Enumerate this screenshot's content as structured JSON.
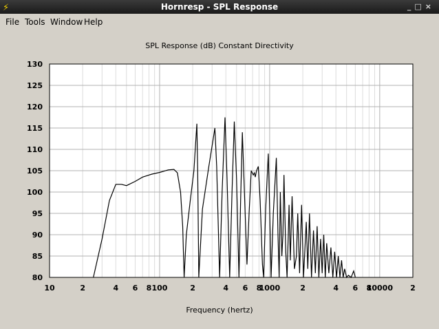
{
  "window": {
    "title": "Hornresp - SPL Response",
    "controls": [
      "_",
      "□",
      "×"
    ]
  },
  "menu": [
    "File",
    "Tools",
    "Window",
    "Help"
  ],
  "chart_data": {
    "type": "line",
    "title": "SPL Response (dB)   Constant Directivity",
    "xlabel": "Frequency (hertz)",
    "ylabel": "",
    "xscale": "log",
    "xlim": [
      10,
      20000
    ],
    "ylim": [
      80,
      130
    ],
    "yticks": [
      "130",
      "125",
      "120",
      "115",
      "110",
      "105",
      "100",
      "95",
      "90",
      "85",
      "80"
    ],
    "xticks": [
      {
        "v": 10,
        "l": "10"
      },
      {
        "v": 20,
        "l": "2"
      },
      {
        "v": 40,
        "l": "4"
      },
      {
        "v": 60,
        "l": "6"
      },
      {
        "v": 80,
        "l": "8"
      },
      {
        "v": 100,
        "l": "100"
      },
      {
        "v": 200,
        "l": "2"
      },
      {
        "v": 400,
        "l": "4"
      },
      {
        "v": 600,
        "l": "6"
      },
      {
        "v": 800,
        "l": "8"
      },
      {
        "v": 1000,
        "l": "1000"
      },
      {
        "v": 2000,
        "l": "2"
      },
      {
        "v": 4000,
        "l": "4"
      },
      {
        "v": 6000,
        "l": "6"
      },
      {
        "v": 8000,
        "l": "8"
      },
      {
        "v": 10000,
        "l": "10000"
      },
      {
        "v": 20000,
        "l": "2"
      }
    ],
    "grid": true,
    "series": [
      {
        "name": "SPL",
        "points": [
          [
            25,
            80
          ],
          [
            30,
            89
          ],
          [
            35,
            98
          ],
          [
            40,
            101.8
          ],
          [
            45,
            101.8
          ],
          [
            50,
            101.5
          ],
          [
            60,
            102.5
          ],
          [
            70,
            103.5
          ],
          [
            85,
            104.2
          ],
          [
            100,
            104.6
          ],
          [
            120,
            105.2
          ],
          [
            135,
            105.3
          ],
          [
            145,
            104.5
          ],
          [
            155,
            100
          ],
          [
            162,
            92
          ],
          [
            167,
            80
          ],
          [
            175,
            90
          ],
          [
            190,
            98
          ],
          [
            205,
            105
          ],
          [
            218,
            116
          ],
          [
            222,
            105
          ],
          [
            227,
            80
          ],
          [
            245,
            96
          ],
          [
            280,
            106
          ],
          [
            305,
            112
          ],
          [
            318,
            115
          ],
          [
            330,
            106
          ],
          [
            351,
            80
          ],
          [
            370,
            100
          ],
          [
            393,
            117.5
          ],
          [
            410,
            103
          ],
          [
            433,
            80
          ],
          [
            455,
            100
          ],
          [
            477,
            116.5
          ],
          [
            500,
            103
          ],
          [
            526,
            80
          ],
          [
            545,
            98
          ],
          [
            565,
            114
          ],
          [
            590,
            100
          ],
          [
            622,
            83
          ],
          [
            650,
            95
          ],
          [
            680,
            105
          ],
          [
            710,
            104
          ],
          [
            726,
            104.5
          ],
          [
            740,
            103.5
          ],
          [
            760,
            105
          ],
          [
            789,
            106
          ],
          [
            820,
            98
          ],
          [
            860,
            83
          ],
          [
            881,
            80
          ],
          [
            920,
            96
          ],
          [
            972,
            109
          ],
          [
            1000,
            96
          ],
          [
            1030,
            80
          ],
          [
            1080,
            95
          ],
          [
            1150,
            108
          ],
          [
            1190,
            90
          ],
          [
            1220,
            80
          ],
          [
            1250,
            100
          ],
          [
            1290,
            85
          ],
          [
            1320,
            90
          ],
          [
            1350,
            104
          ],
          [
            1400,
            86
          ],
          [
            1440,
            80
          ],
          [
            1500,
            97
          ],
          [
            1540,
            84
          ],
          [
            1600,
            99
          ],
          [
            1680,
            82
          ],
          [
            1750,
            85
          ],
          [
            1800,
            95
          ],
          [
            1870,
            81
          ],
          [
            1950,
            97
          ],
          [
            2030,
            80
          ],
          [
            2150,
            93
          ],
          [
            2220,
            82
          ],
          [
            2300,
            95
          ],
          [
            2400,
            80
          ],
          [
            2500,
            91
          ],
          [
            2600,
            81
          ],
          [
            2700,
            92
          ],
          [
            2800,
            80
          ],
          [
            2900,
            89
          ],
          [
            3000,
            81
          ],
          [
            3100,
            90
          ],
          [
            3200,
            80
          ],
          [
            3300,
            88
          ],
          [
            3450,
            81
          ],
          [
            3600,
            87
          ],
          [
            3750,
            80
          ],
          [
            3900,
            86
          ],
          [
            4050,
            80
          ],
          [
            4200,
            85
          ],
          [
            4350,
            80
          ],
          [
            4500,
            84
          ],
          [
            4650,
            80
          ],
          [
            4800,
            82
          ],
          [
            5000,
            80
          ],
          [
            5200,
            80.5
          ],
          [
            5500,
            80
          ],
          [
            5800,
            81.5
          ],
          [
            6000,
            80
          ]
        ]
      }
    ]
  }
}
